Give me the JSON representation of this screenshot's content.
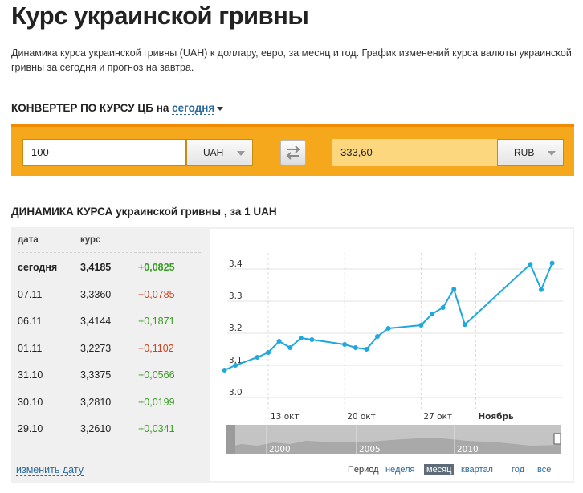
{
  "page": {
    "title": "Курс украинской гривны",
    "description": "Динамика курса украинской гривны (UAH) к доллару, евро, за месяц и год. График изменений курса валюты украинской гривны за сегодня и прогноз на завтра."
  },
  "converter": {
    "heading": "КОНВЕРТЕР ПО КУРСУ ЦБ на",
    "date_link": "сегодня",
    "amount": "100",
    "from_currency": "UAH",
    "result": "333,60",
    "to_currency": "RUB"
  },
  "dynamics": {
    "heading_bold": "ДИНАМИКА КУРСА",
    "heading_rest": "украинской гривны , за 1 UAH",
    "col_date": "дата",
    "col_rate": "курс",
    "rows": [
      {
        "date": "сегодня",
        "rate": "3,4185",
        "change": "+0,0825",
        "dir": "pos"
      },
      {
        "date": "07.11",
        "rate": "3,3360",
        "change": "−0,0785",
        "dir": "neg"
      },
      {
        "date": "06.11",
        "rate": "3,4144",
        "change": "+0,1871",
        "dir": "pos"
      },
      {
        "date": "01.11",
        "rate": "3,2273",
        "change": "−0,1102",
        "dir": "neg"
      },
      {
        "date": "31.10",
        "rate": "3,3375",
        "change": "+0,0566",
        "dir": "pos"
      },
      {
        "date": "30.10",
        "rate": "3,2810",
        "change": "+0,0199",
        "dir": "pos"
      },
      {
        "date": "29.10",
        "rate": "3,2610",
        "change": "+0,0341",
        "dir": "pos"
      }
    ],
    "change_date_link": "изменить дату"
  },
  "chart_data": {
    "type": "line",
    "ylim": [
      2.98,
      3.48
    ],
    "yticks": [
      3.0,
      3.1,
      3.2,
      3.3,
      3.4
    ],
    "ytick_labels": [
      "3.0",
      "3.1",
      "3.2",
      "3.3",
      "3.4"
    ],
    "xticks": [
      {
        "label": "13 окт",
        "day": 13
      },
      {
        "label": "20 окт",
        "day": 20
      },
      {
        "label": "27 окт",
        "day": 27
      },
      {
        "label": "Ноябрь",
        "day": 32
      }
    ],
    "xlim": [
      13,
      40
    ],
    "x": [
      9,
      10,
      12,
      13,
      14,
      15,
      16,
      17,
      20,
      21,
      22,
      23,
      24,
      27,
      28,
      29,
      30,
      31,
      37,
      38,
      39
    ],
    "y": [
      3.085,
      3.1,
      3.125,
      3.14,
      3.175,
      3.155,
      3.185,
      3.18,
      3.165,
      3.155,
      3.15,
      3.19,
      3.215,
      3.225,
      3.26,
      3.28,
      3.337,
      3.227,
      3.4144,
      3.336,
      3.4185
    ],
    "line_color": "#1fa8dd",
    "grid": true,
    "navigator_labels": [
      "2000",
      "2005",
      "2010"
    ]
  },
  "periods": {
    "label": "Период",
    "items": [
      "неделя",
      "месяц",
      "квартал",
      "год",
      "все"
    ],
    "active": "месяц"
  },
  "colors": {
    "accent_orange": "#f5a81c",
    "result_bg": "#fcd77e",
    "link": "#2a6a9c",
    "positive": "#3a9d23",
    "negative": "#d2401c"
  }
}
